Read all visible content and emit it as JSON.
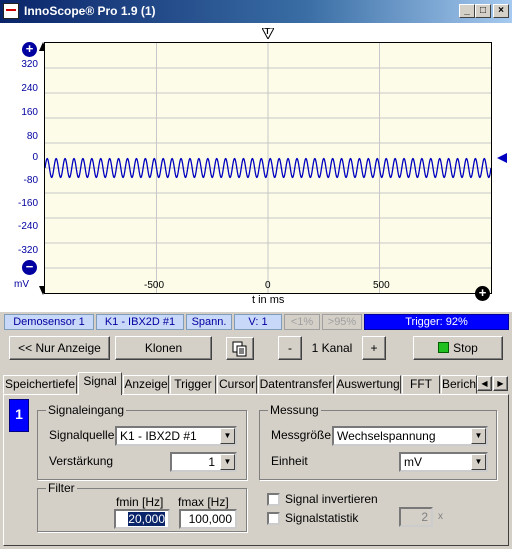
{
  "window": {
    "title": "InnoScope® Pro 1.9 (1)",
    "buttons": [
      "_",
      "□",
      "×"
    ]
  },
  "scope": {
    "trigger_marker": "T",
    "y_unit": "mV",
    "x_label": "t in ms",
    "trace_color": "#0000c0",
    "chart_data": {
      "type": "line",
      "title": "",
      "xlabel": "t in ms",
      "ylabel": "mV",
      "xlim": [
        -1000,
        1000
      ],
      "ylim": [
        -400,
        400
      ],
      "y_ticks": [
        "320",
        "240",
        "160",
        "80",
        "0",
        "-80",
        "-160",
        "-240",
        "-320"
      ],
      "x_ticks": [
        "-500",
        "0",
        "500"
      ],
      "series": [
        {
          "signal": "sine",
          "amplitude_mV": 30,
          "cycles": 50
        }
      ],
      "grid": true
    }
  },
  "status": {
    "source": "Demosensor 1",
    "channel": "K1 - IBX2D #1",
    "mode": "Spann.",
    "view": "V: 1",
    "low": "<1%",
    "high": ">95%",
    "trigger": "Trigger: 92%"
  },
  "toolbar": {
    "nur_anzeige": "<< Nur Anzeige",
    "klonen": "Klonen",
    "minus": "-",
    "kanal": "1 Kanal",
    "plus": "+",
    "stop": "Stop"
  },
  "tabs": [
    "Speichertiefe",
    "Signal",
    "Anzeige",
    "Trigger",
    "Cursor",
    "Datentransfer",
    "Auswertung",
    "FFT",
    "Berich"
  ],
  "active_tab": "Signal",
  "panel": {
    "channel_number": "1",
    "signaleingang": {
      "title": "Signaleingang",
      "signalquelle_label": "Signalquelle",
      "signalquelle_value": "K1 - IBX2D #1",
      "verstaerkung_label": "Verstärkung",
      "verstaerkung_value": "1"
    },
    "filter": {
      "title": "Filter",
      "fmin_label": "fmin [Hz]",
      "fmin_value": "20,000",
      "fmax_label": "fmax [Hz]",
      "fmax_value": "100,000"
    },
    "messung": {
      "title": "Messung",
      "messgroesse_label": "Messgröße",
      "messgroesse_value": "Wechselspannung",
      "einheit_label": "Einheit",
      "einheit_value": "mV"
    },
    "signal_invertieren": "Signal invertieren",
    "signalstatistik": "Signalstatistik",
    "statistik_value": "2",
    "statistik_unit": "x"
  }
}
